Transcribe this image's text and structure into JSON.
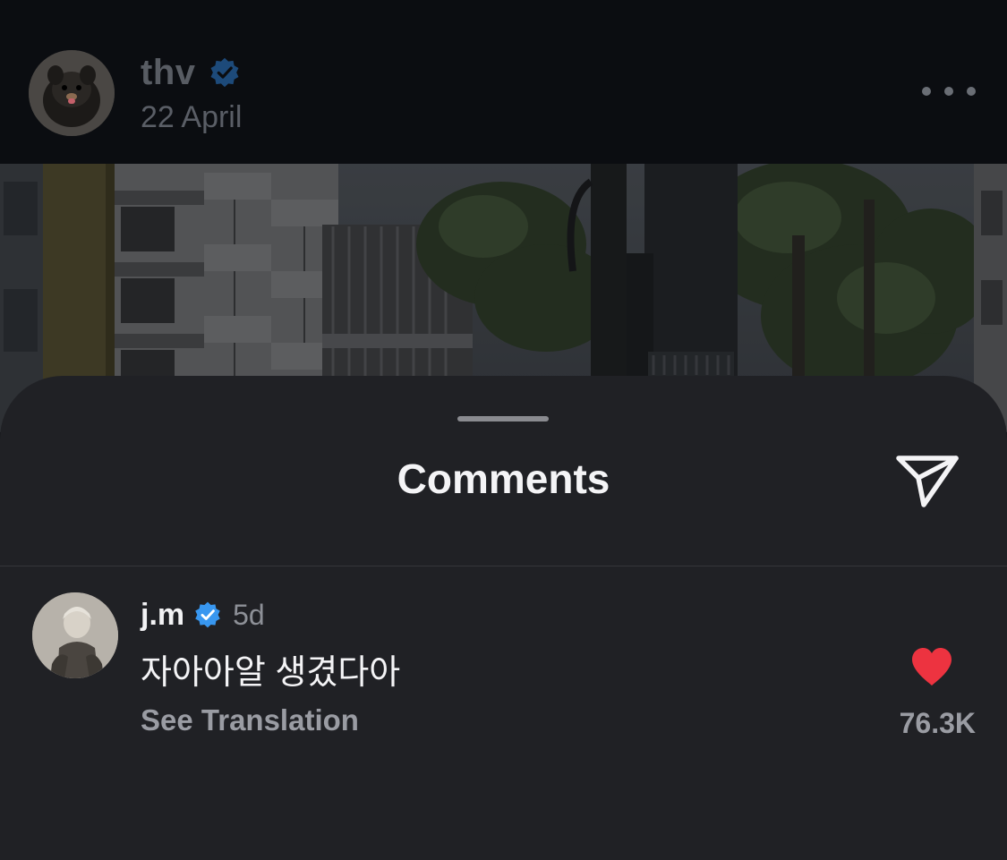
{
  "post": {
    "username": "thv",
    "verified": true,
    "date": "22 April",
    "more_icon": "more-horizontal-icon"
  },
  "sheet": {
    "title": "Comments",
    "share_icon": "send-icon"
  },
  "comment": {
    "username": "j.m",
    "verified": true,
    "time": "5d",
    "text": "자아아알 생겼다아",
    "translation_label": "See Translation",
    "like_icon": "heart-icon",
    "liked": true,
    "like_count": "76.3K"
  },
  "colors": {
    "sheet_background": "#202125",
    "verified_blue": "#3897f0",
    "like_red": "#ed3340"
  }
}
